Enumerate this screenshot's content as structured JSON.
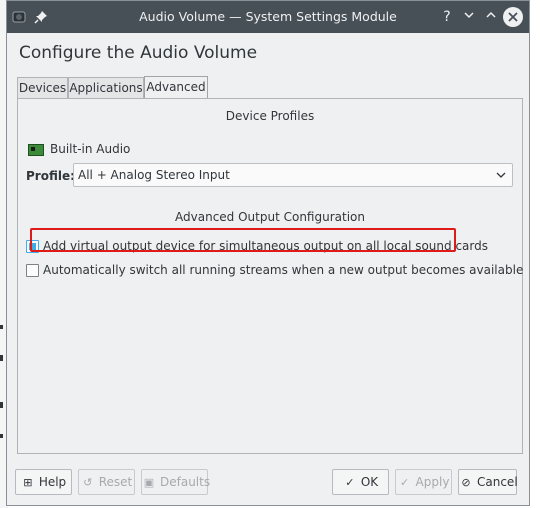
{
  "window": {
    "title": "Audio Volume — System Settings Module",
    "buttons": {
      "help": "?",
      "minimize": "⌄",
      "maximize": "⌃"
    }
  },
  "page": {
    "heading": "Configure the Audio Volume"
  },
  "tabs": [
    {
      "label": "Devices",
      "active": false
    },
    {
      "label": "Applications",
      "active": false
    },
    {
      "label": "Advanced",
      "active": true
    }
  ],
  "advanced": {
    "device_profiles_title": "Device Profiles",
    "device_name": "Built-in Audio",
    "profile_label": "Profile:",
    "profile_value": "All + Analog Stereo Input",
    "output_config_title": "Advanced Output Configuration",
    "options": [
      {
        "label": "Add virtual output device for simultaneous output on all local sound cards",
        "checked": true
      },
      {
        "label": "Automatically switch all running streams when a new output becomes available",
        "checked": false
      }
    ]
  },
  "footer": {
    "help": "Help",
    "reset": "Reset",
    "defaults": "Defaults",
    "ok": "OK",
    "apply": "Apply",
    "cancel": "Cancel"
  },
  "colors": {
    "titlebar": "#475057",
    "accent": "#3daee9",
    "highlight": "#e0191b"
  }
}
